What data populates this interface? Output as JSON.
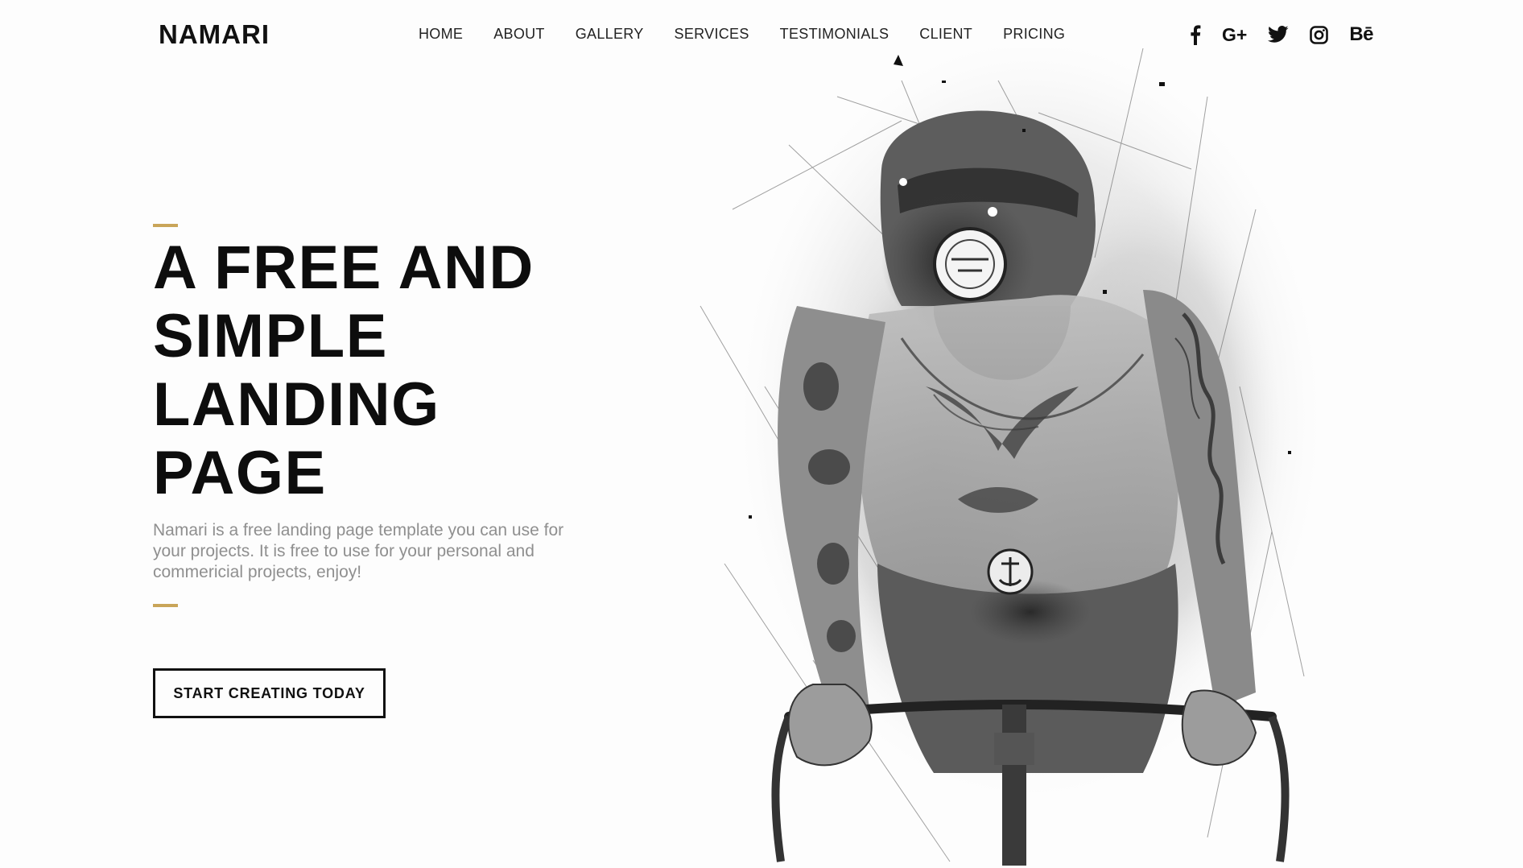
{
  "brand": {
    "name": "NAMARI"
  },
  "nav": {
    "items": [
      {
        "label": "HOME"
      },
      {
        "label": "ABOUT"
      },
      {
        "label": "GALLERY"
      },
      {
        "label": "SERVICES"
      },
      {
        "label": "TESTIMONIALS"
      },
      {
        "label": "CLIENT"
      },
      {
        "label": "PRICING"
      }
    ]
  },
  "social": {
    "icons": [
      "facebook-icon",
      "google-plus-icon",
      "twitter-icon",
      "instagram-icon",
      "behance-icon"
    ],
    "google_plus_label": "G+",
    "behance_label": "Bē"
  },
  "hero": {
    "title_lines": [
      "A FREE AND",
      "SIMPLE",
      "LANDING",
      "PAGE"
    ],
    "description": "Namari is a free landing page template you can use for your projects. It is free to use for your personal and commericial projects, enjoy!",
    "cta_label": "START CREATING TODAY"
  },
  "colors": {
    "accent": "#c9a559",
    "text": "#0d0d0d",
    "muted": "#8f8f8f"
  }
}
